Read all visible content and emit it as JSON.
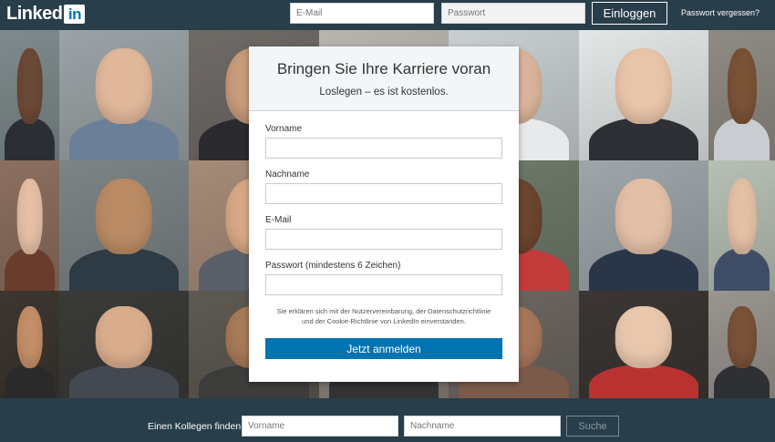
{
  "header": {
    "logo_text": "Linked",
    "logo_badge": "in",
    "email_placeholder": "E-Mail",
    "password_placeholder": "Passwort",
    "login_label": "Einloggen",
    "forgot_label": "Passwort vergessen?"
  },
  "signup": {
    "title": "Bringen Sie Ihre Karriere voran",
    "subtitle": "Loslegen – es ist kostenlos.",
    "fields": {
      "first_name_label": "Vorname",
      "last_name_label": "Nachname",
      "email_label": "E-Mail",
      "password_label": "Passwort (mindestens 6 Zeichen)"
    },
    "terms_text": "Sie erklären sich mit der Nutzervereinbarung, der Datenschutzrichtlinie und der Cookie-Richtlinie von LinkedIn einverstanden.",
    "submit_label": "Jetzt anmelden"
  },
  "footer": {
    "find_label": "Einen Kollegen finden",
    "first_name_placeholder": "Vorname",
    "last_name_placeholder": "Nachname",
    "search_label": "Suche"
  },
  "colors": {
    "brand": "#0073b1",
    "header_bg": "#283e4a"
  },
  "background_photos": [
    {
      "name": "photo-man-suit-left",
      "bg": "#7e8a8c",
      "skin": "#6b4a36",
      "cloth": "#2b2f35"
    },
    {
      "name": "photo-woman-blonde-smiling",
      "bg": "#9aa3a6",
      "skin": "#e0b79a",
      "cloth": "#6c7f99"
    },
    {
      "name": "photo-man-dark-hair",
      "bg": "#6f6a66",
      "skin": "#c89b7b",
      "cloth": "#2a2a2e"
    },
    {
      "name": "photo-hidden-behind-card-1",
      "bg": "#b8b4ae",
      "skin": "#d2a98c",
      "cloth": "#3d4550"
    },
    {
      "name": "photo-man-window",
      "bg": "#c9cfd2",
      "skin": "#d9b49a",
      "cloth": "#e7e9ea"
    },
    {
      "name": "photo-woman-asian-long-hair",
      "bg": "#e3e6e6",
      "skin": "#e8c4a8",
      "cloth": "#2d2f34"
    },
    {
      "name": "photo-man-smiling-right",
      "bg": "#8f8b84",
      "skin": "#7a5236",
      "cloth": "#c9ccd0"
    },
    {
      "name": "photo-woman-red-hair",
      "bg": "#8c6f5f",
      "skin": "#e6bfa5",
      "cloth": "#6a3c2b"
    },
    {
      "name": "photo-man-sunglasses",
      "bg": "#7d8486",
      "skin": "#b98a64",
      "cloth": "#2e3a44"
    },
    {
      "name": "photo-woman-portrait",
      "bg": "#a58b78",
      "skin": "#d8a886",
      "cloth": "#59606a"
    },
    {
      "name": "photo-hidden-behind-card-2",
      "bg": "#9d9a93",
      "skin": "#c79b7c",
      "cloth": "#4c3a30"
    },
    {
      "name": "photo-woman-curly-hair",
      "bg": "#6f7a6a",
      "skin": "#6b452d",
      "cloth": "#c23b3b"
    },
    {
      "name": "photo-man-tie",
      "bg": "#9ea6aa",
      "skin": "#e2bfa6",
      "cloth": "#2a3548"
    },
    {
      "name": "photo-woman-outdoor",
      "bg": "#b8c0b5",
      "skin": "#e5c0a5",
      "cloth": "#3f4e66"
    },
    {
      "name": "photo-man-smile-bottom",
      "bg": "#3d3630",
      "skin": "#c48f68",
      "cloth": "#2a2a2a"
    },
    {
      "name": "photo-young-man-asian",
      "bg": "#3a3a38",
      "skin": "#d9ad8c",
      "cloth": "#444850"
    },
    {
      "name": "photo-man-beard",
      "bg": "#5e5a52",
      "skin": "#a77a58",
      "cloth": "#3c3c3a"
    },
    {
      "name": "photo-hidden-behind-card-3",
      "bg": "#8a837a",
      "skin": "#d8b195",
      "cloth": "#333"
    },
    {
      "name": "photo-man-laughing",
      "bg": "#6d6761",
      "skin": "#a6765a",
      "cloth": "#7b5a4a"
    },
    {
      "name": "photo-woman-asian-smile",
      "bg": "#3b3634",
      "skin": "#e9c7ad",
      "cloth": "#b83330"
    },
    {
      "name": "photo-man-bottom-right",
      "bg": "#9a958f",
      "skin": "#7a5238",
      "cloth": "#2f3034"
    }
  ]
}
